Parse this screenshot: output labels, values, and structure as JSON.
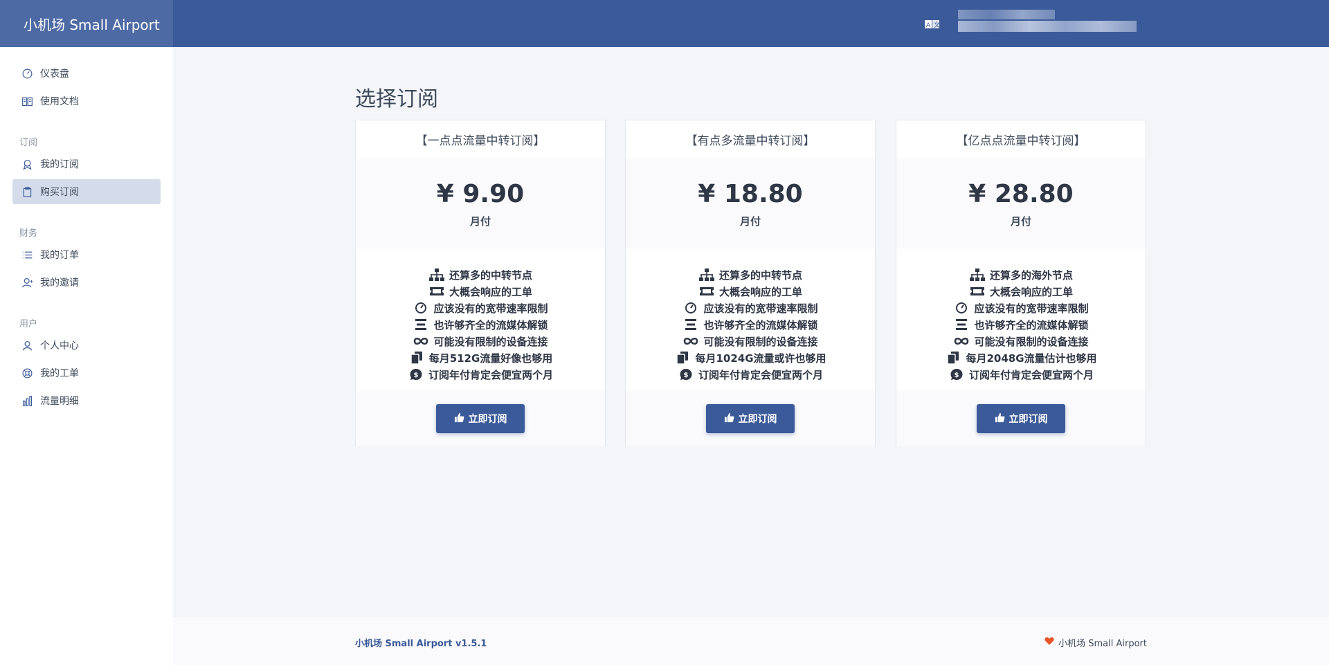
{
  "app": {
    "brand": "小机场 Small Airport"
  },
  "header": {
    "lang_icon": "translate-icon"
  },
  "sidebar": {
    "items_top": [
      {
        "label": "仪表盘",
        "icon": "dashboard-icon"
      },
      {
        "label": "使用文档",
        "icon": "book-icon"
      }
    ],
    "sections": [
      {
        "title": "订阅",
        "items": [
          {
            "label": "我的订阅",
            "icon": "badge-icon"
          },
          {
            "label": "购买订阅",
            "icon": "clipboard-icon",
            "active": true
          }
        ]
      },
      {
        "title": "财务",
        "items": [
          {
            "label": "我的订单",
            "icon": "list-icon"
          },
          {
            "label": "我的邀请",
            "icon": "user-plus-icon"
          }
        ]
      },
      {
        "title": "用户",
        "items": [
          {
            "label": "个人中心",
            "icon": "user-icon"
          },
          {
            "label": "我的工单",
            "icon": "lifebuoy-icon"
          },
          {
            "label": "流量明细",
            "icon": "bar-chart-icon"
          }
        ]
      }
    ]
  },
  "main": {
    "title": "选择订阅",
    "plans": [
      {
        "name": "【一点点流量中转订阅】",
        "price": "¥ 9.90",
        "period": "月付",
        "features": [
          "还算多的中转节点",
          "大概会响应的工单",
          "应该没有的宽带速率限制",
          "也许够齐全的流媒体解锁",
          "可能没有限制的设备连接",
          "每月512G流量好像也够用",
          "订阅年付肯定会便宜两个月"
        ],
        "button": "立即订阅"
      },
      {
        "name": "【有点多流量中转订阅】",
        "price": "¥ 18.80",
        "period": "月付",
        "features": [
          "还算多的中转节点",
          "大概会响应的工单",
          "应该没有的宽带速率限制",
          "也许够齐全的流媒体解锁",
          "可能没有限制的设备连接",
          "每月1024G流量或许也够用",
          "订阅年付肯定会便宜两个月"
        ],
        "button": "立即订阅"
      },
      {
        "name": "【亿点点流量中转订阅】",
        "price": "¥ 28.80",
        "period": "月付",
        "features": [
          "还算多的海外节点",
          "大概会响应的工单",
          "应该没有的宽带速率限制",
          "也许够齐全的流媒体解锁",
          "可能没有限制的设备连接",
          "每月2048G流量估计也够用",
          "订阅年付肯定会便宜两个月"
        ],
        "button": "立即订阅"
      }
    ],
    "feature_icons": [
      "sitemap-icon",
      "ticket-icon",
      "gauge-icon",
      "bars-icon",
      "infinity-icon",
      "copy-icon",
      "dollar-icon"
    ]
  },
  "footer": {
    "left": "小机场 Small Airport v1.5.1",
    "right": "小机场 Small Airport"
  },
  "colors": {
    "primary": "#3b5a99",
    "heart": "#e8542a",
    "bg": "#f4f5f9"
  }
}
